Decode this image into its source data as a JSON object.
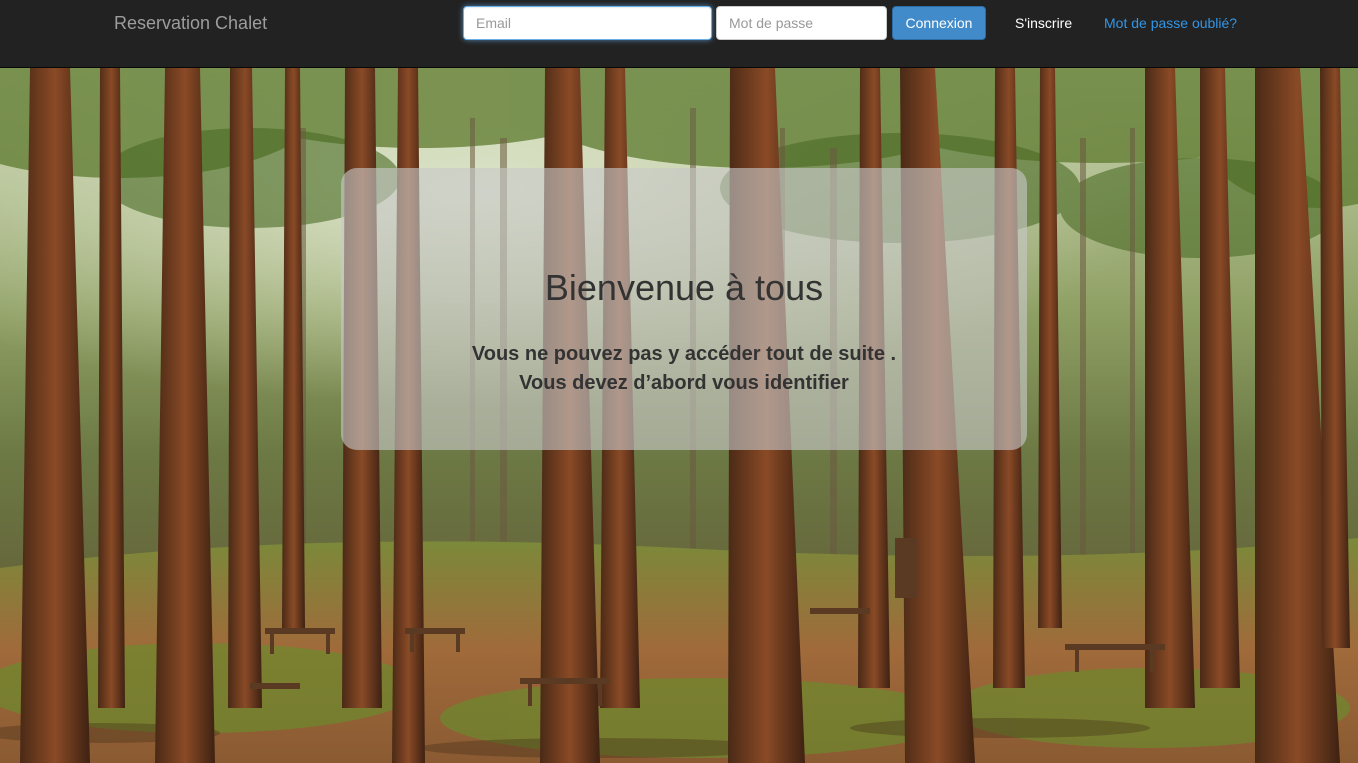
{
  "navbar": {
    "brand": "Reservation Chalet",
    "email_placeholder": "Email",
    "password_placeholder": "Mot de passe",
    "login_label": "Connexion",
    "signup_label": "S'inscrire",
    "forgot_label": "Mot de passe oublié?"
  },
  "welcome": {
    "title": "Bienvenue à tous",
    "line1": "Vous ne pouvez pas y accéder tout de suite .",
    "line2": "Vous devez d’abord vous identifier"
  },
  "colors": {
    "navbar_bg": "#222222",
    "brand": "#9d9d9d",
    "primary_button": "#428bca",
    "link": "#3296e6"
  }
}
